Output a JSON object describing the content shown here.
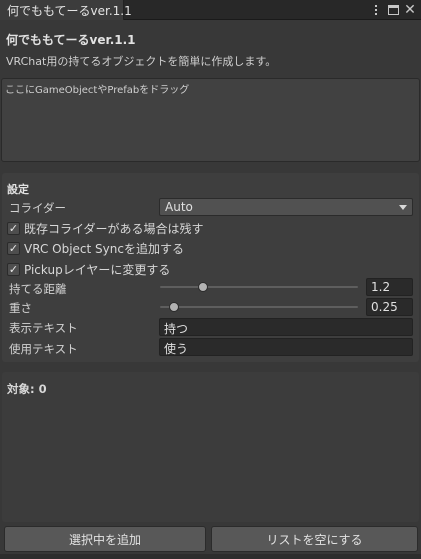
{
  "window": {
    "tab_title": "何でももてーるver.1.1"
  },
  "header": {
    "title": "何でももてーるver.1.1",
    "description": "VRChat用の持てるオブジェクトを簡単に作成します。"
  },
  "dropzone": {
    "text": "ここにGameObjectやPrefabをドラッグ"
  },
  "settings": {
    "section_title": "設定",
    "collider": {
      "label": "コライダー",
      "value": "Auto"
    },
    "keep_existing_collider": {
      "label": "既存コライダーがある場合は残す",
      "checked": true
    },
    "add_object_sync": {
      "label": "VRC Object Syncを追加する",
      "checked": true
    },
    "change_to_pickup_layer": {
      "label": "Pickupレイヤーに変更する",
      "checked": true
    },
    "grab_distance": {
      "label": "持てる距離",
      "value": "1.2",
      "fraction": 0.2
    },
    "weight": {
      "label": "重さ",
      "value": "0.25",
      "fraction": 0.05
    },
    "display_text": {
      "label": "表示テキスト",
      "value": "持つ"
    },
    "use_text": {
      "label": "使用テキスト",
      "value": "使う"
    }
  },
  "targets": {
    "label": "対象: 0"
  },
  "buttons": {
    "add_selected": "選択中を追加",
    "clear_list": "リストを空にする"
  },
  "icons": {
    "check": "✓",
    "close": "✕"
  }
}
